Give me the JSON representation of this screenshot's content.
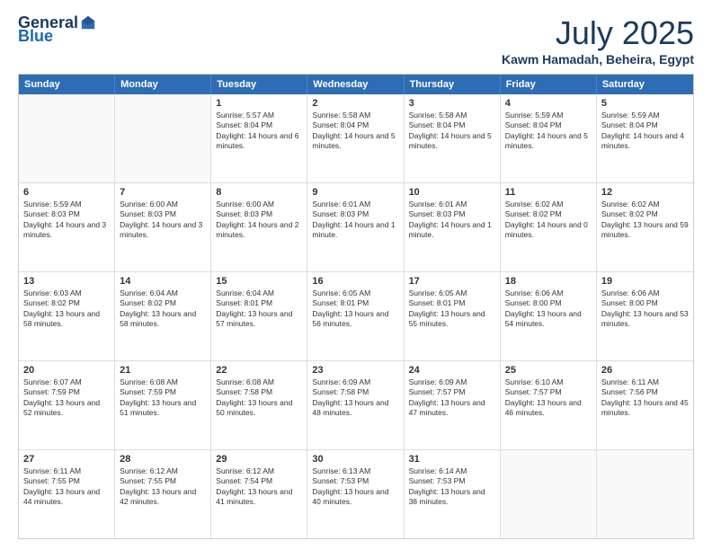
{
  "header": {
    "logo": {
      "general": "General",
      "blue": "Blue"
    },
    "month": "July 2025",
    "location": "Kawm Hamadah, Beheira, Egypt"
  },
  "weekdays": [
    "Sunday",
    "Monday",
    "Tuesday",
    "Wednesday",
    "Thursday",
    "Friday",
    "Saturday"
  ],
  "rows": [
    [
      {
        "day": "",
        "empty": true
      },
      {
        "day": "",
        "empty": true
      },
      {
        "day": "1",
        "sunrise": "5:57 AM",
        "sunset": "8:04 PM",
        "daylight": "14 hours and 6 minutes."
      },
      {
        "day": "2",
        "sunrise": "5:58 AM",
        "sunset": "8:04 PM",
        "daylight": "14 hours and 5 minutes."
      },
      {
        "day": "3",
        "sunrise": "5:58 AM",
        "sunset": "8:04 PM",
        "daylight": "14 hours and 5 minutes."
      },
      {
        "day": "4",
        "sunrise": "5:59 AM",
        "sunset": "8:04 PM",
        "daylight": "14 hours and 5 minutes."
      },
      {
        "day": "5",
        "sunrise": "5:59 AM",
        "sunset": "8:04 PM",
        "daylight": "14 hours and 4 minutes."
      }
    ],
    [
      {
        "day": "6",
        "sunrise": "5:59 AM",
        "sunset": "8:03 PM",
        "daylight": "14 hours and 3 minutes."
      },
      {
        "day": "7",
        "sunrise": "6:00 AM",
        "sunset": "8:03 PM",
        "daylight": "14 hours and 3 minutes."
      },
      {
        "day": "8",
        "sunrise": "6:00 AM",
        "sunset": "8:03 PM",
        "daylight": "14 hours and 2 minutes."
      },
      {
        "day": "9",
        "sunrise": "6:01 AM",
        "sunset": "8:03 PM",
        "daylight": "14 hours and 1 minute."
      },
      {
        "day": "10",
        "sunrise": "6:01 AM",
        "sunset": "8:03 PM",
        "daylight": "14 hours and 1 minute."
      },
      {
        "day": "11",
        "sunrise": "6:02 AM",
        "sunset": "8:02 PM",
        "daylight": "14 hours and 0 minutes."
      },
      {
        "day": "12",
        "sunrise": "6:02 AM",
        "sunset": "8:02 PM",
        "daylight": "13 hours and 59 minutes."
      }
    ],
    [
      {
        "day": "13",
        "sunrise": "6:03 AM",
        "sunset": "8:02 PM",
        "daylight": "13 hours and 58 minutes."
      },
      {
        "day": "14",
        "sunrise": "6:04 AM",
        "sunset": "8:02 PM",
        "daylight": "13 hours and 58 minutes."
      },
      {
        "day": "15",
        "sunrise": "6:04 AM",
        "sunset": "8:01 PM",
        "daylight": "13 hours and 57 minutes."
      },
      {
        "day": "16",
        "sunrise": "6:05 AM",
        "sunset": "8:01 PM",
        "daylight": "13 hours and 56 minutes."
      },
      {
        "day": "17",
        "sunrise": "6:05 AM",
        "sunset": "8:01 PM",
        "daylight": "13 hours and 55 minutes."
      },
      {
        "day": "18",
        "sunrise": "6:06 AM",
        "sunset": "8:00 PM",
        "daylight": "13 hours and 54 minutes."
      },
      {
        "day": "19",
        "sunrise": "6:06 AM",
        "sunset": "8:00 PM",
        "daylight": "13 hours and 53 minutes."
      }
    ],
    [
      {
        "day": "20",
        "sunrise": "6:07 AM",
        "sunset": "7:59 PM",
        "daylight": "13 hours and 52 minutes."
      },
      {
        "day": "21",
        "sunrise": "6:08 AM",
        "sunset": "7:59 PM",
        "daylight": "13 hours and 51 minutes."
      },
      {
        "day": "22",
        "sunrise": "6:08 AM",
        "sunset": "7:58 PM",
        "daylight": "13 hours and 50 minutes."
      },
      {
        "day": "23",
        "sunrise": "6:09 AM",
        "sunset": "7:58 PM",
        "daylight": "13 hours and 48 minutes."
      },
      {
        "day": "24",
        "sunrise": "6:09 AM",
        "sunset": "7:57 PM",
        "daylight": "13 hours and 47 minutes."
      },
      {
        "day": "25",
        "sunrise": "6:10 AM",
        "sunset": "7:57 PM",
        "daylight": "13 hours and 46 minutes."
      },
      {
        "day": "26",
        "sunrise": "6:11 AM",
        "sunset": "7:56 PM",
        "daylight": "13 hours and 45 minutes."
      }
    ],
    [
      {
        "day": "27",
        "sunrise": "6:11 AM",
        "sunset": "7:55 PM",
        "daylight": "13 hours and 44 minutes."
      },
      {
        "day": "28",
        "sunrise": "6:12 AM",
        "sunset": "7:55 PM",
        "daylight": "13 hours and 42 minutes."
      },
      {
        "day": "29",
        "sunrise": "6:12 AM",
        "sunset": "7:54 PM",
        "daylight": "13 hours and 41 minutes."
      },
      {
        "day": "30",
        "sunrise": "6:13 AM",
        "sunset": "7:53 PM",
        "daylight": "13 hours and 40 minutes."
      },
      {
        "day": "31",
        "sunrise": "6:14 AM",
        "sunset": "7:53 PM",
        "daylight": "13 hours and 38 minutes."
      },
      {
        "day": "",
        "empty": true
      },
      {
        "day": "",
        "empty": true
      }
    ]
  ]
}
